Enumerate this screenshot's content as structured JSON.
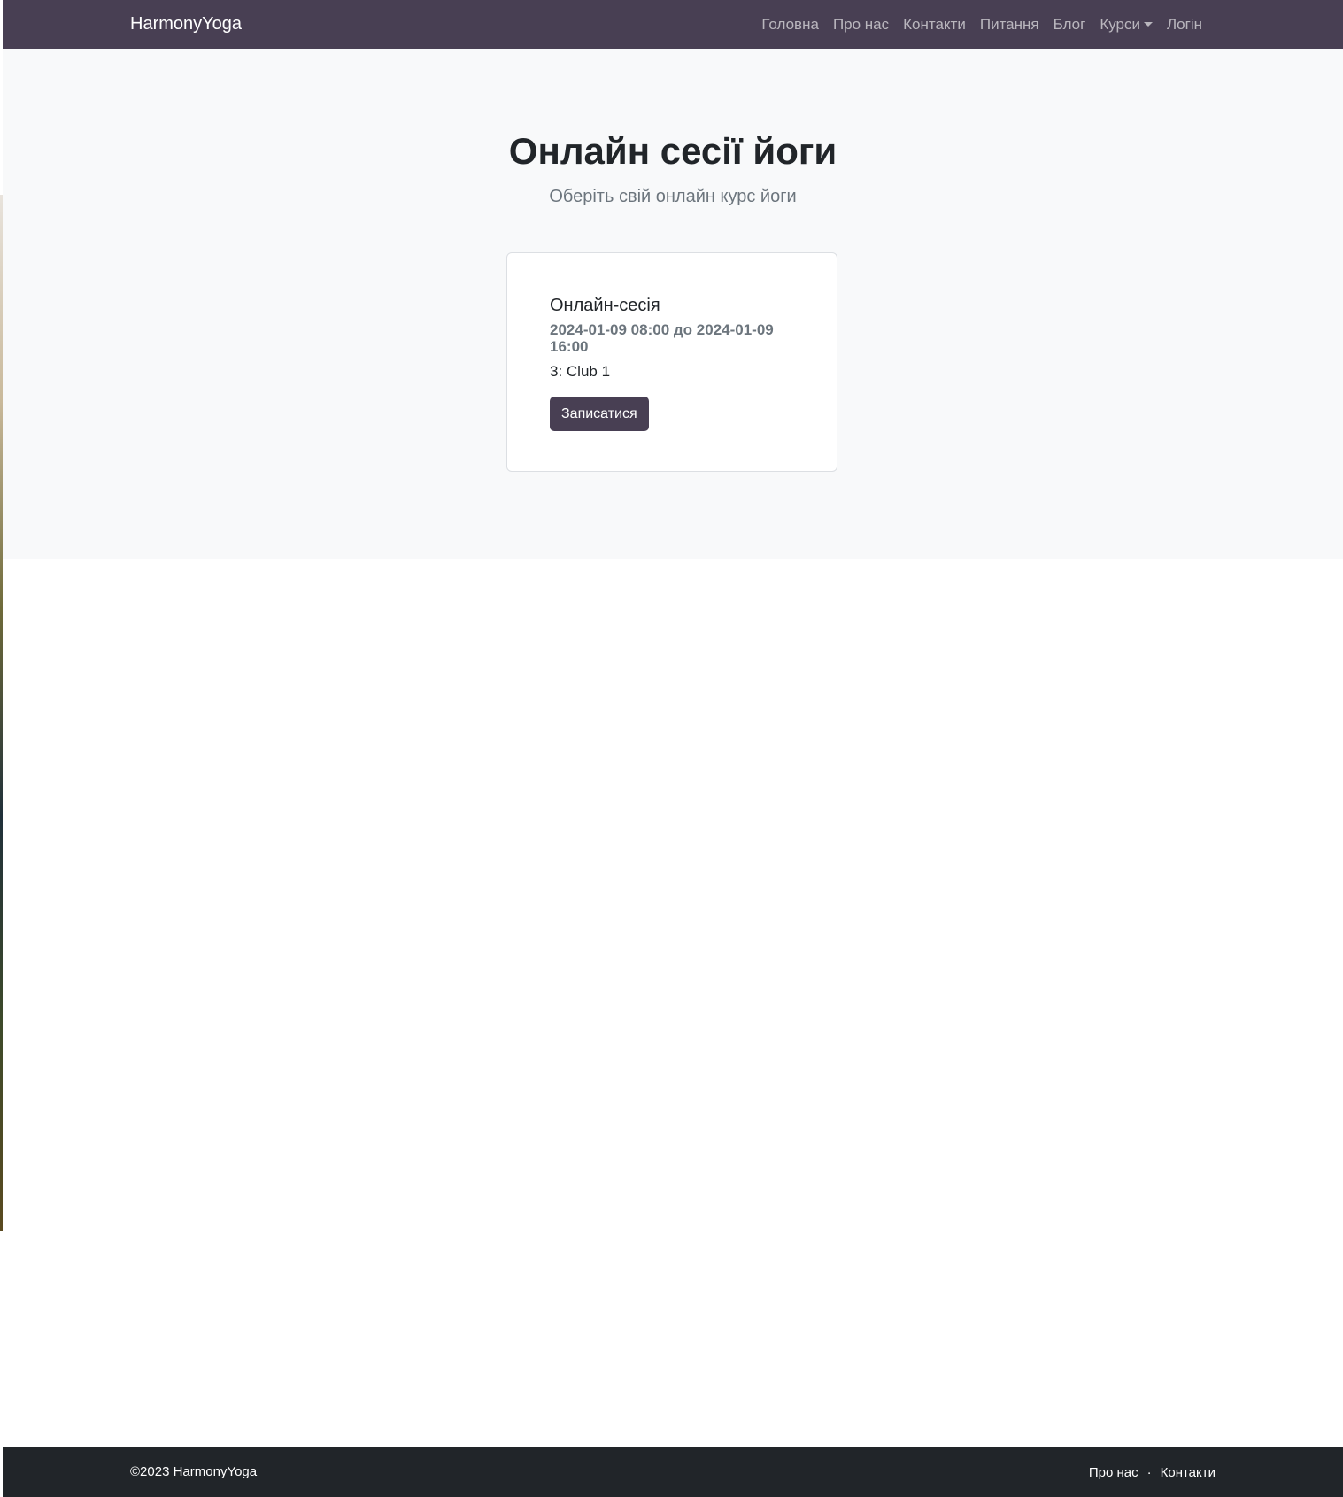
{
  "navbar": {
    "brand": "HarmonyYoga",
    "links": [
      {
        "label": "Головна"
      },
      {
        "label": "Про нас"
      },
      {
        "label": "Контакти"
      },
      {
        "label": "Питання"
      },
      {
        "label": "Блог"
      },
      {
        "label": "Курси",
        "dropdown": true
      },
      {
        "label": "Логін"
      }
    ]
  },
  "hero": {
    "title": "Онлайн сесії йоги",
    "subtitle": "Оберіть свій онлайн курс йоги"
  },
  "session_card": {
    "title": "Онлайн-сесія",
    "datetime": "2024-01-09 08:00 до 2024-01-09 16:00",
    "club": "3: Club 1",
    "button_label": "Записатися"
  },
  "footer": {
    "copyright": "©2023 HarmonyYoga",
    "links": [
      {
        "label": "Про нас"
      },
      {
        "label": "Контакти"
      }
    ],
    "separator": "·"
  },
  "colors": {
    "navbar_bg": "#483f53",
    "hero_bg": "#f8f9fa",
    "button_bg": "#483f53",
    "footer_bg": "#212529"
  }
}
